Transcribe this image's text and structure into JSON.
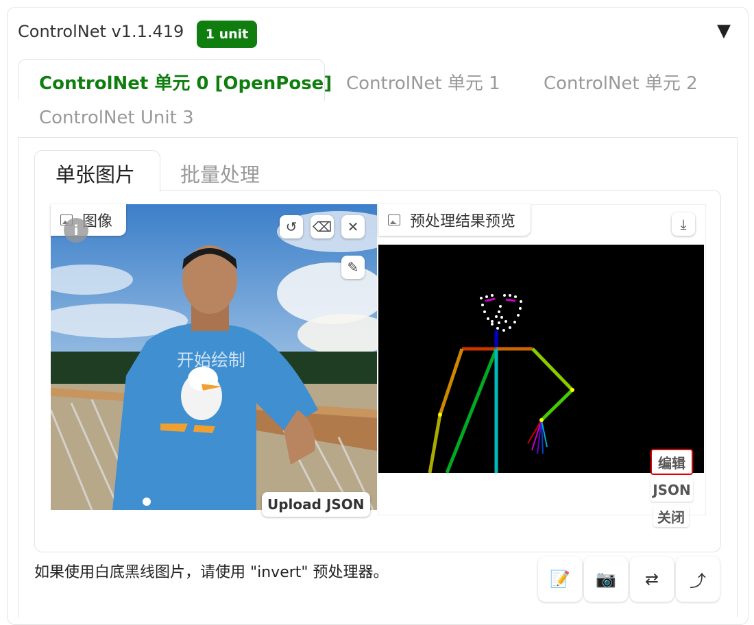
{
  "header": {
    "title": "ControlNet v1.1.419",
    "badge": "1 unit",
    "collapse_glyph": "▼"
  },
  "unit_tabs": [
    {
      "label": "ControlNet 单元 0 [OpenPose]",
      "active": true
    },
    {
      "label": "ControlNet 单元 1",
      "active": false
    },
    {
      "label": "ControlNet 单元 2",
      "active": false
    },
    {
      "label": "ControlNet Unit 3",
      "active": false
    }
  ],
  "mode_tabs": [
    {
      "label": "单张图片",
      "active": true
    },
    {
      "label": "批量处理",
      "active": false
    }
  ],
  "image_panel": {
    "label": "图像",
    "label_icon": "image-icon",
    "info_glyph": "i",
    "overlay_text": "开始绘制",
    "upload_json_label": "Upload JSON",
    "tools": [
      {
        "name": "undo-icon",
        "glyph": "↺"
      },
      {
        "name": "eraser-icon",
        "glyph": "⌫"
      },
      {
        "name": "close-icon",
        "glyph": "✕"
      },
      {
        "name": "brush-icon",
        "glyph": "✎"
      }
    ]
  },
  "preview_panel": {
    "label": "预处理结果预览",
    "label_icon": "image-icon",
    "download_glyph": "⤓",
    "side_buttons": {
      "edit": "编辑",
      "json": "JSON",
      "close": "关闭"
    }
  },
  "note": "如果使用白底黑线图片，请使用 \"invert\" 预处理器。",
  "bottom_buttons": [
    {
      "name": "edit-note-icon",
      "glyph": "📝"
    },
    {
      "name": "camera-icon",
      "glyph": "📷"
    },
    {
      "name": "swap-icon",
      "glyph": "⇄"
    },
    {
      "name": "send-dimensions-icon",
      "glyph": "⤴"
    }
  ],
  "colors": {
    "accent_green": "#0f7e0f",
    "highlight_red": "#e00000"
  }
}
